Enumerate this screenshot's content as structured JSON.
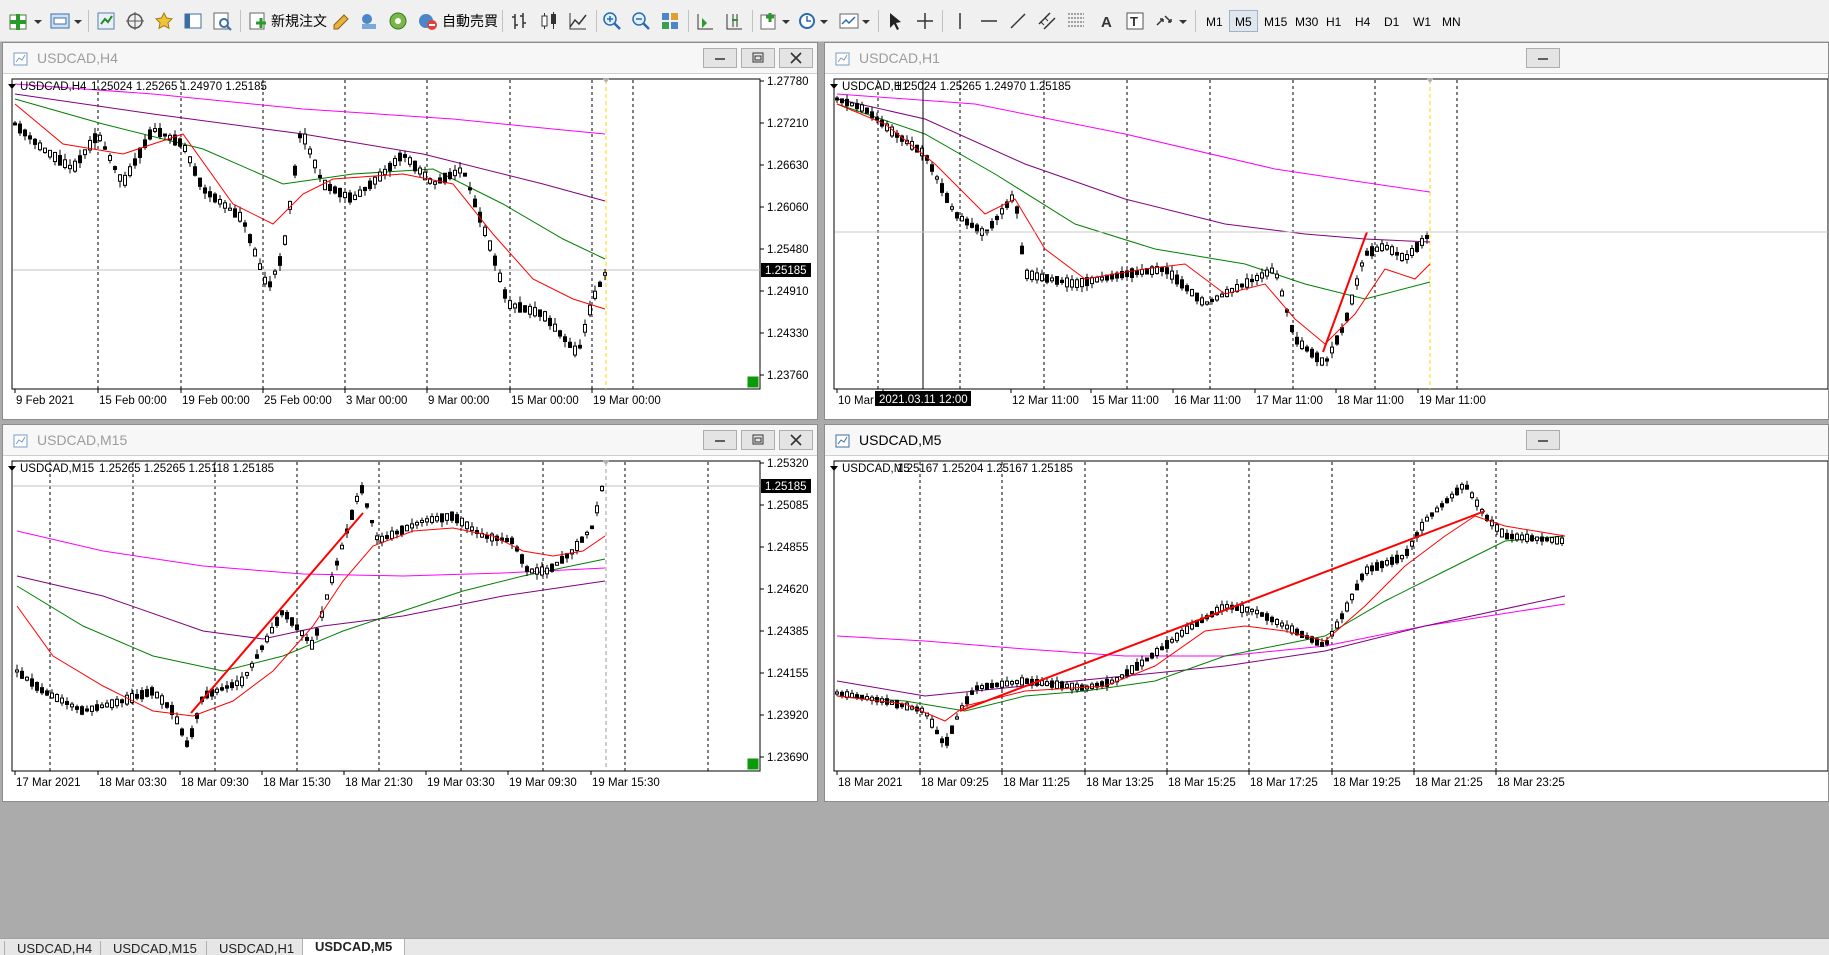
{
  "toolbar": {
    "new_order": "新規注文",
    "auto_trading": "自動売買",
    "timeframes": [
      "M1",
      "M5",
      "M15",
      "M30",
      "H1",
      "H4",
      "D1",
      "W1",
      "MN"
    ],
    "active_timeframe": "M5"
  },
  "windows": [
    {
      "title": "USDCAD,H4",
      "info_symbol": "USDCAD,H4",
      "info_ohlc": "1.25024 1.25265 1.24970 1.25185",
      "price_labels": [
        "1.27780",
        "1.27210",
        "1.26630",
        "1.26060",
        "1.25480",
        "1.24910",
        "1.24330",
        "1.23760"
      ],
      "current_price": "1.25185",
      "time_labels": [
        "9 Feb 2021",
        "15 Feb 00:00",
        "19 Feb 00:00",
        "25 Feb 00:00",
        "3 Mar 00:00",
        "9 Mar 00:00",
        "15 Mar 00:00",
        "19 Mar 00:00"
      ]
    },
    {
      "title": "USDCAD,H1",
      "info_symbol": "USDCAD,H1",
      "info_ohlc": "1.25024 1.25265 1.24970 1.25185",
      "crosshair_time": "2021.03.11 12:00",
      "time_labels": [
        "10 Mar 2",
        "00",
        "12 Mar 11:00",
        "15 Mar 11:00",
        "16 Mar 11:00",
        "17 Mar 11:00",
        "18 Mar 11:00",
        "19 Mar 11:00"
      ]
    },
    {
      "title": "USDCAD,M15",
      "info_symbol": "USDCAD,M15",
      "info_ohlc": "1.25265 1.25265 1.25118 1.25185",
      "price_labels": [
        "1.25320",
        "1.25085",
        "1.24855",
        "1.24620",
        "1.24385",
        "1.24155",
        "1.23920",
        "1.23690"
      ],
      "current_price": "1.25185",
      "time_labels": [
        "17 Mar 2021",
        "18 Mar 03:30",
        "18 Mar 09:30",
        "18 Mar 15:30",
        "18 Mar 21:30",
        "19 Mar 03:30",
        "19 Mar 09:30",
        "19 Mar 15:30"
      ]
    },
    {
      "title": "USDCAD,M5",
      "info_symbol": "USDCAD,M5",
      "info_ohlc": "1.25167 1.25204 1.25167 1.25185",
      "time_labels": [
        "18 Mar 2021",
        "18 Mar 09:25",
        "18 Mar 11:25",
        "18 Mar 13:25",
        "18 Mar 15:25",
        "18 Mar 17:25",
        "18 Mar 19:25",
        "18 Mar 21:25",
        "18 Mar 23:25"
      ]
    }
  ],
  "tabs": [
    "USDCAD,H4",
    "USDCAD,M15",
    "USDCAD,H1",
    "USDCAD,M5"
  ],
  "active_tab": "USDCAD,M5",
  "colors": {
    "candle": "#000000",
    "ma_red": "#ff0000",
    "ma_green": "#008000",
    "ma_purple": "#800080",
    "ma_magenta": "#ff00ff",
    "trendline": "#ff0000",
    "period_separator": "#000000",
    "current_bar_marker": "#ffd700"
  }
}
